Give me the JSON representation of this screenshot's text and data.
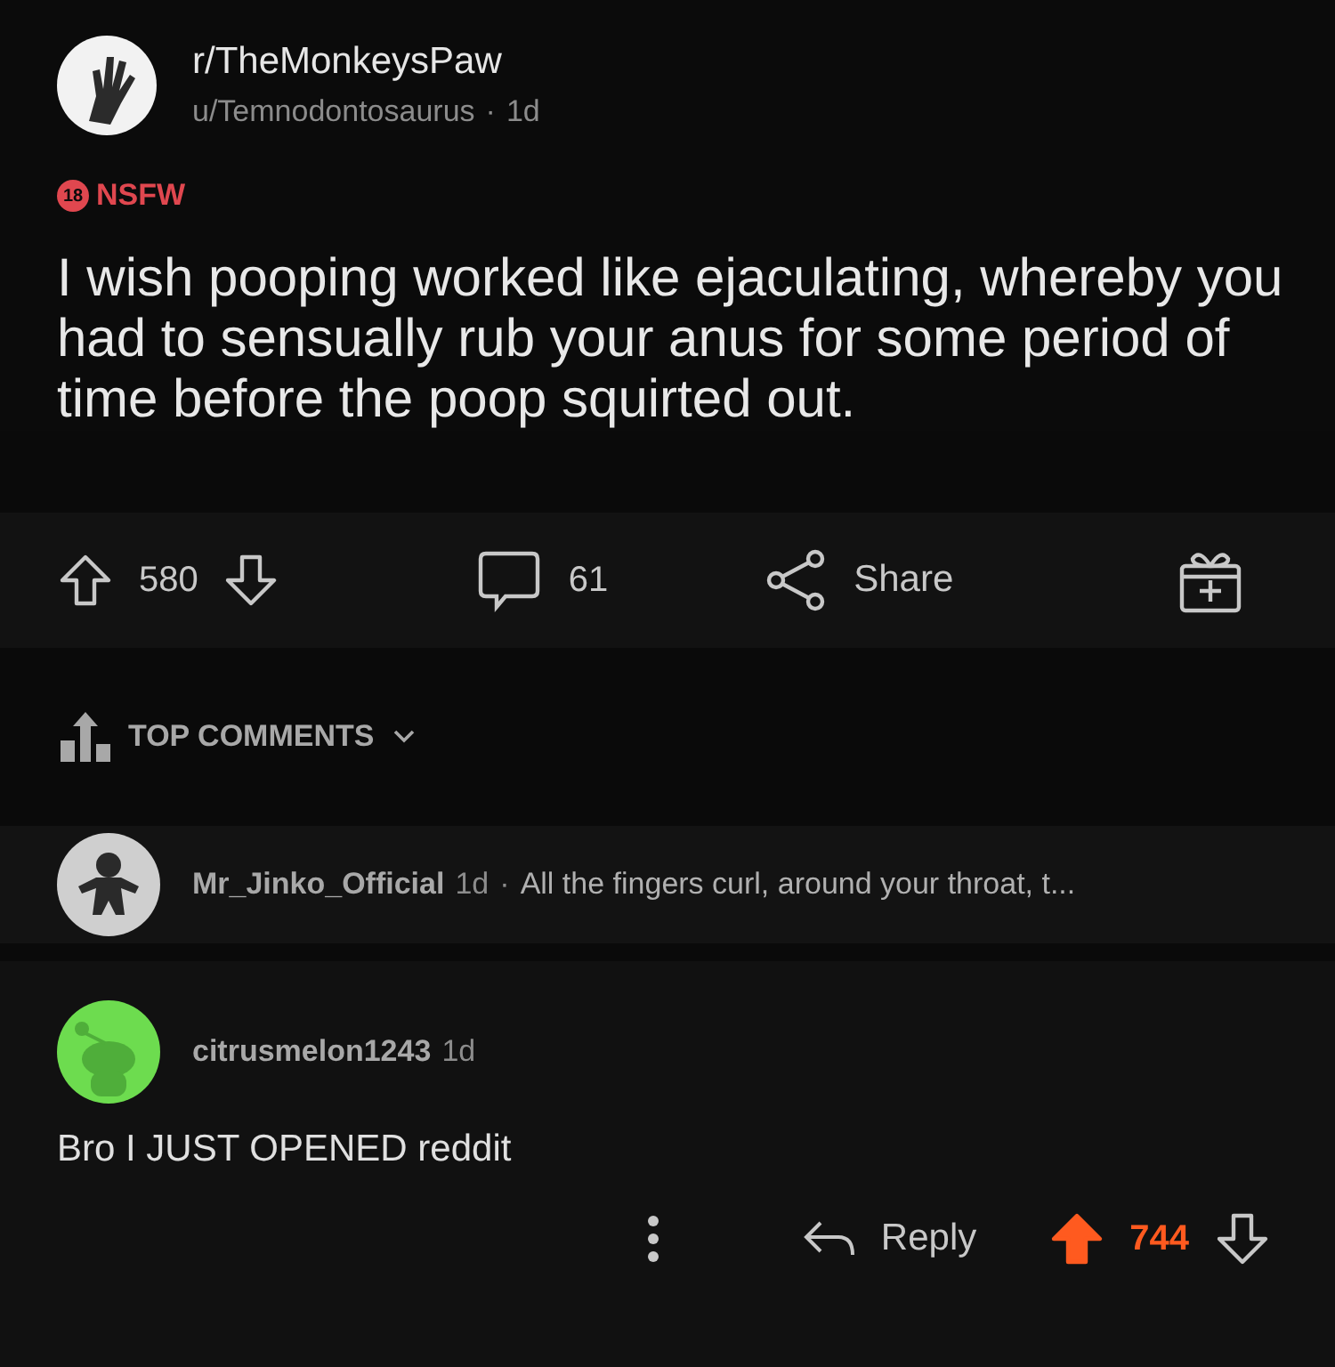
{
  "post": {
    "subreddit": "r/TheMonkeysPaw",
    "author": "u/Temnodontosaurus",
    "separator": "·",
    "age": "1d",
    "nsfw": {
      "badge": "18",
      "label": "NSFW"
    },
    "title": "I wish pooping worked like ejaculating, whereby you had to sensually rub your anus for some period of time before the poop squirted out.",
    "upvoted": false,
    "score": "580",
    "comments": "61",
    "share": "Share"
  },
  "sort": {
    "label": "TOP COMMENTS"
  },
  "comments": [
    {
      "kind": "collapsed",
      "author": "Mr_Jinko_Official",
      "age": "1d",
      "separator": "·",
      "preview": "All the fingers curl, around your throat, t..."
    },
    {
      "kind": "expanded",
      "author": "citrusmelon1243",
      "age": "1d",
      "body": "Bro I JUST OPENED reddit",
      "reply": "Reply",
      "upvoted": true,
      "score": "744"
    }
  ]
}
